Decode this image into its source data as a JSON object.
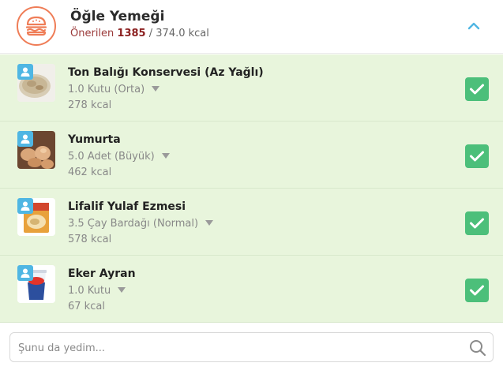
{
  "meal": {
    "title": "Öğle Yemeği",
    "recommended_label": "Önerilen",
    "recommended_value": "1385",
    "separator": "/",
    "consumed": "374.0 kcal",
    "icon": "burger-icon",
    "accent_color": "#ef7d57"
  },
  "items": [
    {
      "name": "Ton Balığı Konservesi (Az Yağlı)",
      "portion": "1.0 Kutu (Orta)",
      "kcal": "278 kcal",
      "checked": true
    },
    {
      "name": "Yumurta",
      "portion": "5.0 Adet (Büyük)",
      "kcal": "462 kcal",
      "checked": true
    },
    {
      "name": "Lifalif Yulaf Ezmesi",
      "portion": "3.5 Çay Bardağı (Normal)",
      "kcal": "578 kcal",
      "checked": true
    },
    {
      "name": "Eker Ayran",
      "portion": "1.0 Kutu",
      "kcal": "67 kcal",
      "checked": true
    }
  ],
  "search": {
    "placeholder": "Şunu da yedim...",
    "icon": "search-icon"
  },
  "colors": {
    "list_bg": "#e8f5dc",
    "check": "#4cbf7a",
    "badge": "#4fb6e3",
    "chevron": "#4fb6e3"
  }
}
